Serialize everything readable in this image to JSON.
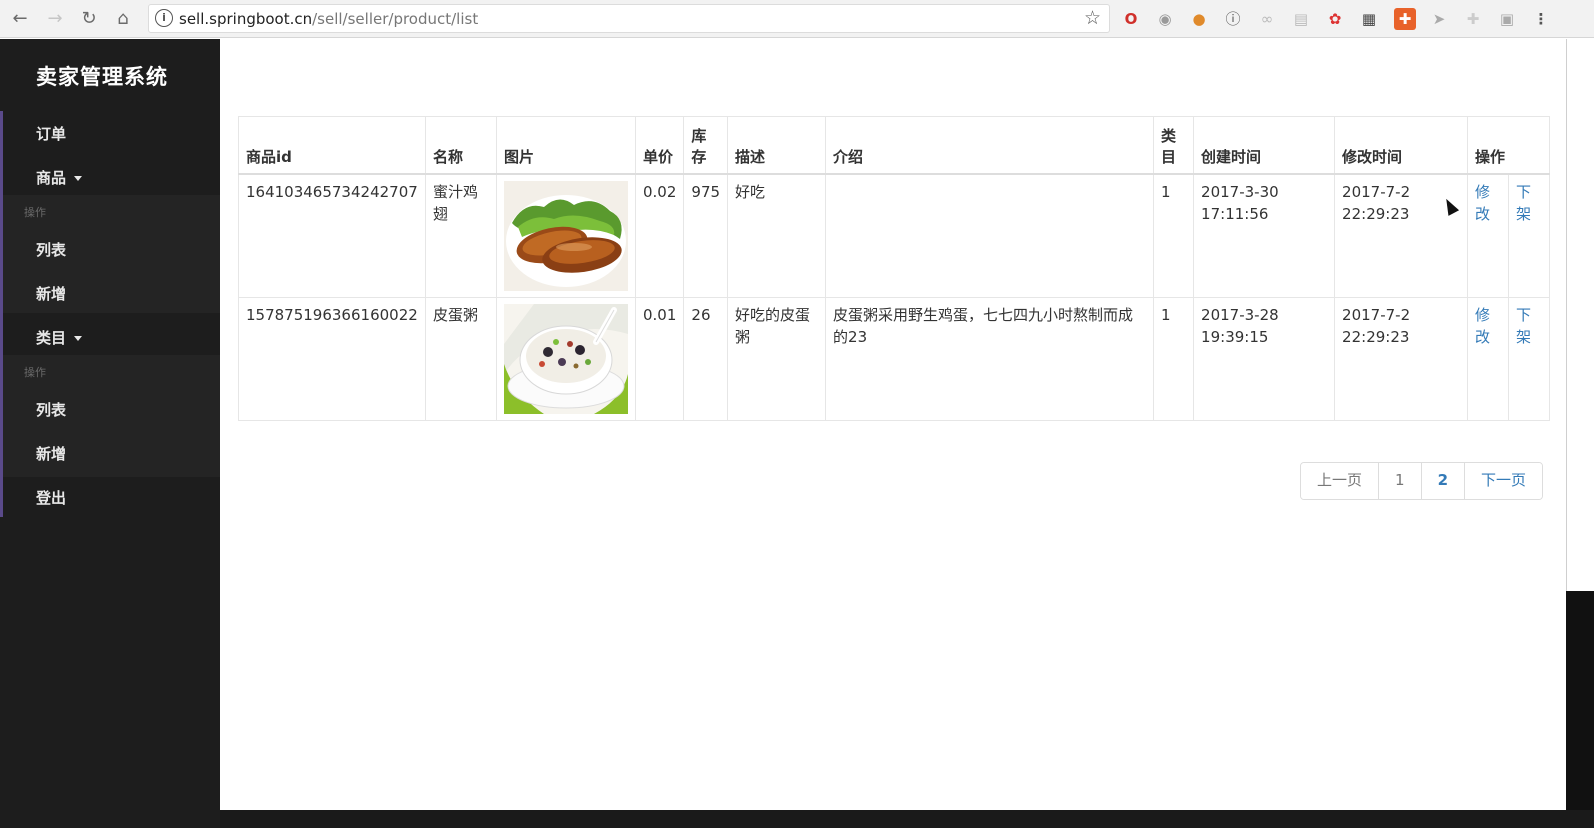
{
  "browser": {
    "url_host": "sell.springboot.cn",
    "url_path": "/sell/seller/product/list"
  },
  "sidebar": {
    "brand": "卖家管理系统",
    "items": [
      {
        "label": "订单"
      },
      {
        "label": "商品"
      },
      {
        "label": "操作"
      },
      {
        "label": "列表"
      },
      {
        "label": "新增"
      },
      {
        "label": "类目"
      },
      {
        "label": "操作"
      },
      {
        "label": "列表"
      },
      {
        "label": "新增"
      },
      {
        "label": "登出"
      }
    ]
  },
  "table": {
    "headers": [
      "商品id",
      "名称",
      "图片",
      "单价",
      "库存",
      "描述",
      "介绍",
      "类目",
      "创建时间",
      "修改时间",
      "操作"
    ],
    "rows": [
      {
        "id": "164103465734242707",
        "name": "蜜汁鸡翅",
        "image": "chicken-wings",
        "price": "0.02",
        "stock": "975",
        "description": "好吃",
        "intro": "",
        "category": "1",
        "create_time": "2017-3-30 17:11:56",
        "update_time": "2017-7-2 22:29:23",
        "edit": "修改",
        "offline": "下架"
      },
      {
        "id": "157875196366160022",
        "name": "皮蛋粥",
        "image": "congee-bowl",
        "price": "0.01",
        "stock": "26",
        "description": "好吃的皮蛋粥",
        "intro": "皮蛋粥采用野生鸡蛋，七七四九小时熬制而成的23",
        "category": "1",
        "create_time": "2017-3-28 19:39:15",
        "update_time": "2017-7-2 22:29:23",
        "edit": "修改",
        "offline": "下架"
      }
    ]
  },
  "pagination": {
    "prev": "上一页",
    "pages": [
      "1",
      "2"
    ],
    "next": "下一页"
  },
  "colors": {
    "sidebar_bg": "#1d1d1d",
    "link": "#337ab7"
  }
}
